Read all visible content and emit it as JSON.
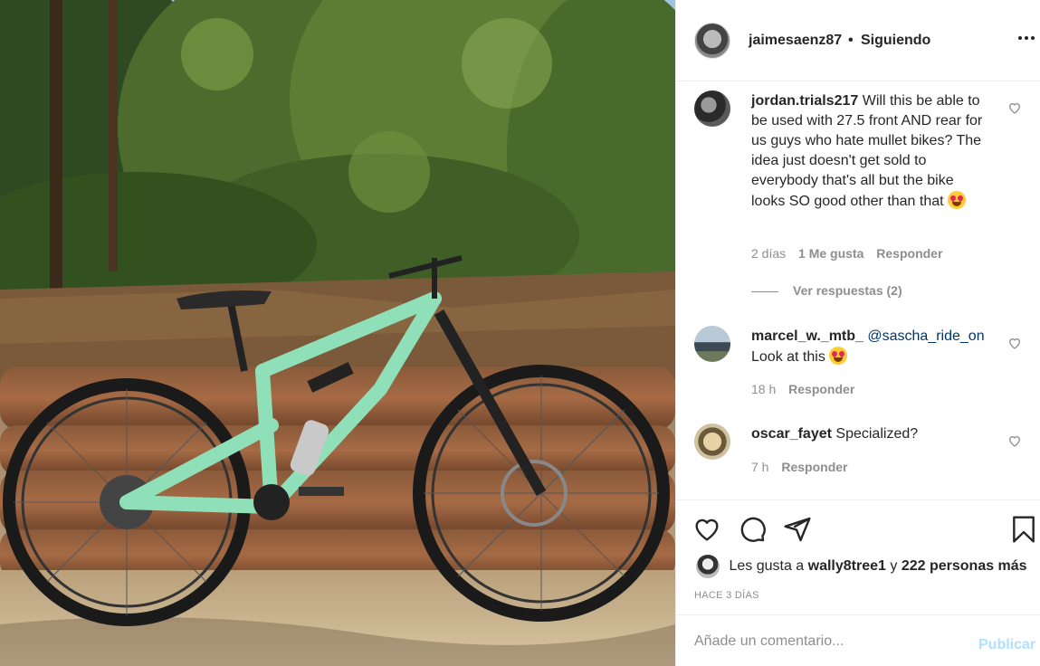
{
  "post": {
    "author": "jaimesaenz87",
    "separator": "•",
    "follow_status": "Siguiendo",
    "more_icon": "more-options-icon",
    "photo_alt": "mountain-bike-photo"
  },
  "comments": [
    {
      "user": "jordan.trials217",
      "text": "Will this be able to be used with 27.5 front AND rear for us guys who hate mullet bikes? The idea just doesn't get sold to everybody that's all but the bike looks SO good other than that",
      "emoji": "heart-eyes-emoji",
      "time": "2 días",
      "likes": "1 Me gusta",
      "reply": "Responder",
      "view_replies": "Ver respuestas (2)"
    },
    {
      "user": "marcel_w._mtb_",
      "mention": "@sascha_ride_on",
      "text": "Look at this",
      "emoji": "heart-eyes-emoji",
      "time": "18 h",
      "reply": "Responder"
    },
    {
      "user": "oscar_fayet",
      "text": "Specialized?",
      "time": "7 h",
      "reply": "Responder"
    }
  ],
  "actions": {
    "like_icon": "heart-icon",
    "comment_icon": "comment-icon",
    "share_icon": "share-icon",
    "save_icon": "bookmark-icon"
  },
  "likes": {
    "prefix": "Les gusta a",
    "user": "wally8tree1",
    "conjunction": "y",
    "others": "222 personas más"
  },
  "timestamp": "HACE 3 DÍAS",
  "add_comment": {
    "placeholder": "Añade un comentario...",
    "publish": "Publicar"
  },
  "colors": {
    "text": "#262626",
    "muted": "#8e8e8e",
    "mention": "#00376b",
    "publish_disabled": "#b2dffc",
    "bike_frame": "#8fe0b8"
  }
}
